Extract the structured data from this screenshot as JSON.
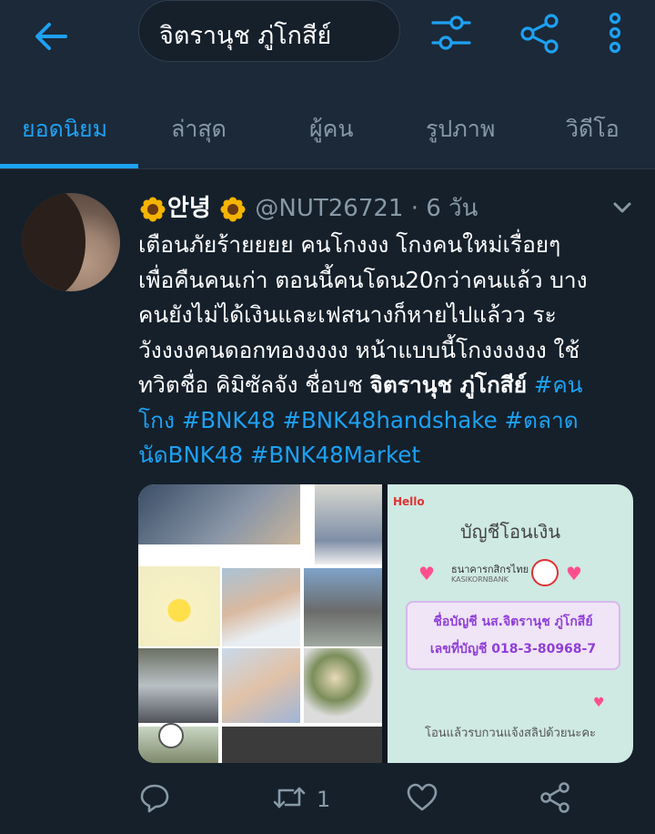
{
  "search": {
    "query": "จิตรานุช ภู่โกสีย์"
  },
  "tabs": [
    {
      "label": "ยอดนิยม",
      "active": true
    },
    {
      "label": "ล่าสุด"
    },
    {
      "label": "ผู้คน"
    },
    {
      "label": "รูปภาพ"
    },
    {
      "label": "วิดีโอ"
    }
  ],
  "tweet": {
    "display_name": "안녕",
    "handle": "@NUT26721",
    "time": "· 6 วัน",
    "lines": [
      [
        "เตือนภัยร้ายยยย คนโกงงง โกงคนใหม่เรื่อยๆ"
      ],
      [
        "เพื่อคืนคนเก่า ตอนนี้คนโดน20กว่าคนแล้ว บาง"
      ],
      [
        "คนยังไม่ได้เงินและเฟสนางก็หายไปแล้วว ระ"
      ],
      [
        "วังงงงคนดอกทองงงงง หน้าแบบนี้โกงงงงงง ใช้"
      ],
      [
        "ทวิตชื่อ คิมิซัลจัง ชื่อบช ",
        "จิตรานุช ภู่โกสีย์",
        " ",
        "#คน"
      ],
      [
        "โกง",
        " ",
        "#BNK48",
        " ",
        "#BNK48handshake",
        " ",
        "#ตลาด"
      ],
      [
        "นัดBNK48",
        " ",
        "#BNK48Market"
      ]
    ],
    "retweet_count": "1"
  },
  "media": {
    "card_title": "บัญชีโอนเงิน",
    "bank_name": "ธนาคารกสิกรไทย",
    "bank_en": "KASIKORNBANK",
    "account_name": "ชื่อบัญชี นส.จิตรานุช ภู่โกสีย์",
    "account_number": "เลขที่บัญชี 018-3-80968-7",
    "note": "โอนแล้วรบกวนแจ้งสลิปด้วยนะคะ",
    "hello_sticker": "Hello"
  },
  "colors": {
    "accent": "#1da1f2",
    "background": "#15202b",
    "bar": "#1c2938",
    "muted": "#8899a6"
  },
  "icons": [
    "back-arrow-icon",
    "filter-icon",
    "share-icon",
    "more-icon",
    "chevron-down-icon",
    "reply-icon",
    "retweet-icon",
    "like-icon",
    "share-icon"
  ]
}
